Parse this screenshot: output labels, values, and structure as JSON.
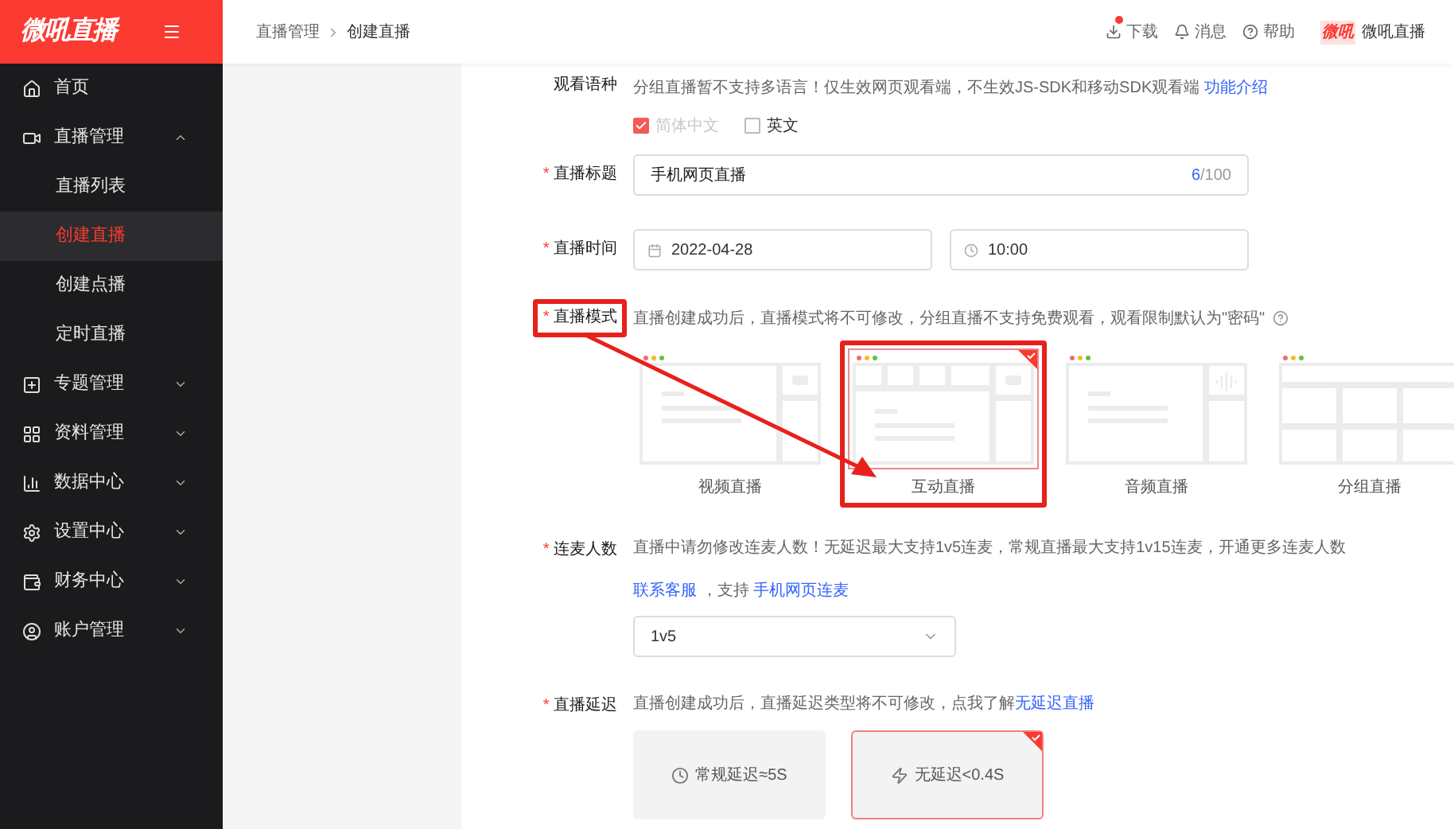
{
  "logo": "微吼直播",
  "sidebar": {
    "items": [
      {
        "label": "首页",
        "selected": false
      },
      {
        "label": "直播管理",
        "selected": false,
        "expanded": true,
        "children": [
          {
            "label": "直播列表",
            "selected": false
          },
          {
            "label": "创建直播",
            "selected": true
          },
          {
            "label": "创建点播",
            "selected": false
          },
          {
            "label": "定时直播",
            "selected": false
          }
        ]
      },
      {
        "label": "专题管理",
        "selected": false,
        "expanded": false
      },
      {
        "label": "资料管理",
        "selected": false,
        "expanded": false
      },
      {
        "label": "数据中心",
        "selected": false,
        "expanded": false
      },
      {
        "label": "设置中心",
        "selected": false,
        "expanded": false
      },
      {
        "label": "财务中心",
        "selected": false,
        "expanded": false
      },
      {
        "label": "账户管理",
        "selected": false,
        "expanded": false
      }
    ]
  },
  "breadcrumb": [
    "直播管理",
    "创建直播"
  ],
  "header_actions": [
    {
      "label": "下载",
      "badge": true
    },
    {
      "label": "消息",
      "badge": false
    },
    {
      "label": "帮助",
      "badge": false
    }
  ],
  "account": {
    "logo": "微吼",
    "name": "微吼直播"
  },
  "form": {
    "language": {
      "label": "观看语种",
      "description": [
        {
          "kind": "text",
          "text": "分组直播暂不支持多语言！仅生效网页观看端，不生效JS-SDK和移动SDK观看端 "
        },
        {
          "kind": "link",
          "text": "功能介绍"
        }
      ],
      "options": [
        {
          "label": "简体中文",
          "checked": true,
          "disabled": true
        },
        {
          "label": "英文",
          "checked": false,
          "disabled": false
        }
      ]
    },
    "title": {
      "label": "直播标题",
      "required_mark": "*",
      "value": "手机网页直播",
      "count": "6",
      "limit": "/100"
    },
    "time": {
      "label": "直播时间",
      "required_mark": "*",
      "date": "2022-04-28",
      "time": "10:00"
    },
    "mode": {
      "label": "直播模式",
      "required_mark": "*",
      "highlighted": true,
      "description": "直播创建成功后，直播模式将不可修改，分组直播不支持免费观看，观看限制默认为\"密码\"",
      "options": [
        {
          "kind": "video",
          "label": "视频直播",
          "selected": false,
          "highlighted": false
        },
        {
          "kind": "interactive",
          "label": "互动直播",
          "selected": true,
          "highlighted": true
        },
        {
          "kind": "audio",
          "label": "音频直播",
          "selected": false,
          "highlighted": false
        },
        {
          "kind": "group",
          "label": "分组直播",
          "selected": false,
          "highlighted": false
        }
      ]
    },
    "cohost": {
      "label": "连麦人数",
      "required_mark": "*",
      "description": [
        {
          "kind": "text",
          "text": "直播中请勿修改连麦人数！无延迟最大支持1v5连麦，常规直播最大支持1v15连麦，开通更多连麦人数 "
        },
        {
          "kind": "link",
          "text": "联系客服"
        },
        {
          "kind": "text",
          "text": " ，支持 "
        },
        {
          "kind": "link",
          "text": "手机网页连麦"
        }
      ],
      "value": "1v5"
    },
    "latency": {
      "label": "直播延迟",
      "required_mark": "*",
      "description": [
        {
          "kind": "text",
          "text": "直播创建成功后，直播延迟类型将不可修改，点我了解"
        },
        {
          "kind": "link",
          "text": "无延迟直播"
        }
      ],
      "options": [
        {
          "kind": "clock",
          "label": "常规延迟≈5S",
          "selected": false
        },
        {
          "kind": "bolt",
          "label": "无延迟<0.4S",
          "selected": true
        }
      ]
    }
  }
}
